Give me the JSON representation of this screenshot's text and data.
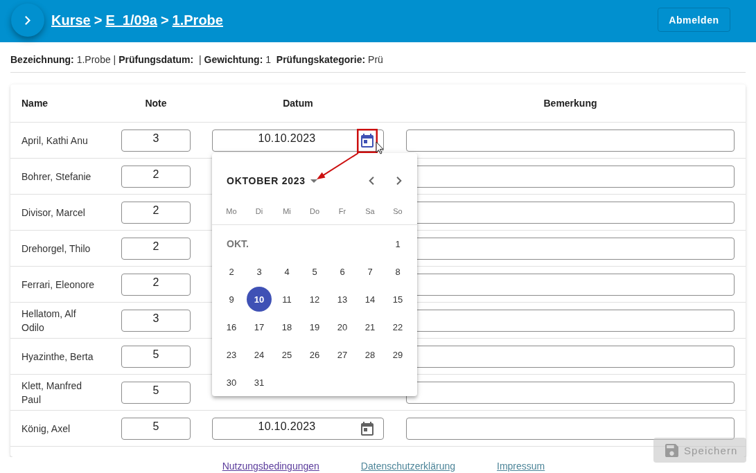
{
  "header": {
    "breadcrumb": [
      {
        "kind": "link",
        "label": "Kurse"
      },
      {
        "kind": "separator",
        "label": ">"
      },
      {
        "kind": "link",
        "label": "E_1/09a"
      },
      {
        "kind": "separator",
        "label": ">"
      },
      {
        "kind": "link",
        "label": "1.Probe"
      }
    ],
    "logout_button": "Abmelden"
  },
  "details": "**Bezeichnung:** 1.Probe | **Prüfungsdatum:**  | **Gewichtung:** 1  **Prüfungskategorie:** Prü",
  "table": {
    "columns": [
      "Name",
      "Note",
      "Datum",
      "Bemerkung"
    ],
    "rows": [
      {
        "name": "April, Kathi Anu",
        "note": "3",
        "date": {
          "value": "10.10.2023",
          "active": true
        }
      },
      {
        "name": "Bohrer, Stefanie",
        "note": "2"
      },
      {
        "name": "Divisor, Marcel",
        "note": "2"
      },
      {
        "name": "Drehorgel, Thilo",
        "note": "2"
      },
      {
        "name": "Ferrari, Eleonore",
        "note": "2"
      },
      {
        "name": "Hellatom, Alf Odilo",
        "note": "3"
      },
      {
        "name": "Hyazinthe, Berta",
        "note": "5"
      },
      {
        "name": "Klett, Manfred Paul",
        "note": "5"
      },
      {
        "name": "König, Axel",
        "note": "5",
        "date": {
          "value": "10.10.2023",
          "active": false
        }
      }
    ]
  },
  "datepicker": {
    "period": "OKTOBER 2023",
    "weekdays": [
      "Mo",
      "Di",
      "Mi",
      "Do",
      "Fr",
      "Sa",
      "So"
    ],
    "month_short": "OKT.",
    "weeks": [
      [
        {
          "label": "1",
          "selected": false
        }
      ],
      [
        {
          "label": "2",
          "selected": false
        },
        {
          "label": "3",
          "selected": false
        },
        {
          "label": "4",
          "selected": false
        },
        {
          "label": "5",
          "selected": false
        },
        {
          "label": "6",
          "selected": false
        },
        {
          "label": "7",
          "selected": false
        },
        {
          "label": "8",
          "selected": false
        }
      ],
      [
        {
          "label": "9",
          "selected": false
        },
        {
          "label": "10",
          "selected": true
        },
        {
          "label": "11",
          "selected": false
        },
        {
          "label": "12",
          "selected": false
        },
        {
          "label": "13",
          "selected": false
        },
        {
          "label": "14",
          "selected": false
        },
        {
          "label": "15",
          "selected": false
        }
      ],
      [
        {
          "label": "16",
          "selected": false
        },
        {
          "label": "17",
          "selected": false
        },
        {
          "label": "18",
          "selected": false
        },
        {
          "label": "19",
          "selected": false
        },
        {
          "label": "20",
          "selected": false
        },
        {
          "label": "21",
          "selected": false
        },
        {
          "label": "22",
          "selected": false
        }
      ],
      [
        {
          "label": "23",
          "selected": false
        },
        {
          "label": "24",
          "selected": false
        },
        {
          "label": "25",
          "selected": false
        },
        {
          "label": "26",
          "selected": false
        },
        {
          "label": "27",
          "selected": false
        },
        {
          "label": "28",
          "selected": false
        },
        {
          "label": "29",
          "selected": false
        }
      ],
      [
        {
          "label": "30",
          "selected": false
        },
        {
          "label": "31",
          "selected": false
        }
      ]
    ]
  },
  "save_button": {
    "label": "Speichern",
    "disabled": true
  },
  "footer": {
    "links": [
      {
        "label": "Nutzungsbedingungen",
        "visited": true
      },
      {
        "label": "Datenschutzerklärung",
        "visited": false
      },
      {
        "label": "Impressum",
        "visited": false
      }
    ]
  }
}
